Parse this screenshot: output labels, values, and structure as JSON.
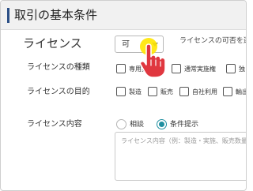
{
  "header": {
    "title": "取引の基本条件"
  },
  "license": {
    "label": "ライセンス",
    "select_value": "可",
    "hint": "ライセンスの可否を選択"
  },
  "license_type": {
    "label": "ライセンスの種類",
    "options": [
      "専用実施権",
      "通常実施権",
      "独占"
    ]
  },
  "license_purpose": {
    "label": "ライセンスの目的",
    "options": [
      "製造",
      "販売",
      "自社利用",
      "輸出"
    ]
  },
  "license_content": {
    "label": "ライセンス内容",
    "radios": [
      {
        "label": "相談",
        "checked": false
      },
      {
        "label": "条件提示",
        "checked": true
      }
    ],
    "placeholder": "ライセンス内容（例：製造・実施、販売数量"
  },
  "colors": {
    "header_accent": "#2b4f86",
    "radio_selected": "#1f8fa0",
    "cursor_highlight": "#ffe600",
    "cursor_hand": "#e0373f"
  },
  "icons": {
    "cursor": "pointing-hand-cursor-icon"
  }
}
